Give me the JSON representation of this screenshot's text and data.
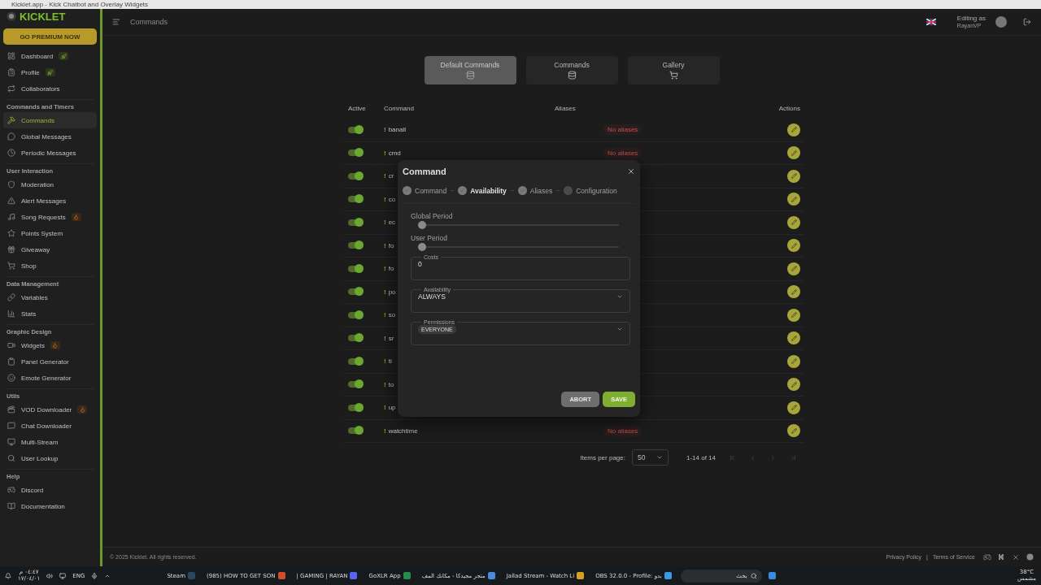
{
  "browser_title": "Kicklet.app - Kick Chatbot and Overlay Widgets",
  "sidebar": {
    "logo": "KICKLET",
    "premium_button": "GO PREMIUM NOW",
    "sections": [
      {
        "items": [
          {
            "label": "Dashboard",
            "kind": "rocket",
            "selected": false
          },
          {
            "label": "Profile",
            "kind": "rocket",
            "selected": false
          },
          {
            "label": "Collaborators",
            "kind": "plain",
            "selected": false
          }
        ]
      },
      {
        "title": "Commands and Timers",
        "items": [
          {
            "label": "Commands",
            "kind": "plain",
            "selected": true
          },
          {
            "label": "Global Messages",
            "kind": "plain",
            "selected": false
          },
          {
            "label": "Periodic Messages",
            "kind": "plain",
            "selected": false
          }
        ]
      },
      {
        "title": "User Interaction",
        "items": [
          {
            "label": "Moderation",
            "kind": "plain",
            "selected": false
          },
          {
            "label": "Alert Messages",
            "kind": "plain",
            "selected": false
          },
          {
            "label": "Song Requests",
            "kind": "fire",
            "selected": false
          },
          {
            "label": "Points System",
            "kind": "plain",
            "selected": false
          },
          {
            "label": "Giveaway",
            "kind": "plain",
            "selected": false
          },
          {
            "label": "Shop",
            "kind": "plain",
            "selected": false
          }
        ]
      },
      {
        "title": "Data Management",
        "items": [
          {
            "label": "Variables",
            "kind": "plain",
            "selected": false
          },
          {
            "label": "Stats",
            "kind": "plain",
            "selected": false
          }
        ]
      },
      {
        "title": "Graphic Design",
        "items": [
          {
            "label": "Widgets",
            "kind": "fire",
            "selected": false
          },
          {
            "label": "Panel Generator",
            "kind": "plain",
            "selected": false
          },
          {
            "label": "Emote Generator",
            "kind": "plain",
            "selected": false
          }
        ]
      },
      {
        "title": "Utils",
        "items": [
          {
            "label": "VOD Downloader",
            "kind": "fire",
            "selected": false
          },
          {
            "label": "Chat Downloader",
            "kind": "plain",
            "selected": false
          },
          {
            "label": "Multi-Stream",
            "kind": "plain",
            "selected": false
          },
          {
            "label": "User Lookup",
            "kind": "plain",
            "selected": false
          }
        ]
      },
      {
        "title": "Help",
        "items": [
          {
            "label": "Discord",
            "kind": "plain",
            "selected": false
          },
          {
            "label": "Documentation",
            "kind": "plain",
            "selected": false
          }
        ]
      }
    ]
  },
  "header": {
    "title": "Commands",
    "editing_label": "Editing as",
    "user": "RayanVP"
  },
  "tabs": [
    {
      "label": "Default Commands",
      "selected": true
    },
    {
      "label": "Commands",
      "selected": false
    },
    {
      "label": "Gallery",
      "selected": false
    }
  ],
  "table": {
    "columns": [
      "Active",
      "Command",
      "Aliases",
      "Actions"
    ],
    "rows": [
      {
        "active": true,
        "prefix": "!",
        "command": "banall",
        "aliases": "No aliases"
      },
      {
        "active": true,
        "prefix": "!",
        "command": "cmd",
        "aliases": "No aliases"
      },
      {
        "active": true,
        "prefix": "!",
        "command": "cr"
      },
      {
        "active": true,
        "prefix": "!",
        "command": "co"
      },
      {
        "active": true,
        "prefix": "!",
        "command": "ec"
      },
      {
        "active": true,
        "prefix": "!",
        "command": "fo"
      },
      {
        "active": true,
        "prefix": "!",
        "command": "fo"
      },
      {
        "active": true,
        "prefix": "!",
        "command": "po"
      },
      {
        "active": true,
        "prefix": "!",
        "command": "so"
      },
      {
        "active": true,
        "prefix": "!",
        "command": "sr"
      },
      {
        "active": true,
        "prefix": "!",
        "command": "ti"
      },
      {
        "active": true,
        "prefix": "!",
        "command": "to"
      },
      {
        "active": true,
        "prefix": "!",
        "command": "up"
      },
      {
        "active": true,
        "prefix": "!",
        "command": "watchtime",
        "aliases": "No aliases"
      }
    ]
  },
  "pagination": {
    "label": "Items per page:",
    "per_page": "50",
    "range": "1-14 of 14"
  },
  "dialog": {
    "title": "Command",
    "steps": [
      {
        "label": "Command",
        "completed": true,
        "selected": false
      },
      {
        "label": "Availability",
        "completed": true,
        "selected": true
      },
      {
        "label": "Aliases",
        "completed": true,
        "selected": false
      },
      {
        "label": "Configuration",
        "completed": false,
        "selected": false
      }
    ],
    "sliders": [
      {
        "label": "Global Period",
        "level": 0
      },
      {
        "label": "User Period",
        "level": 0
      }
    ],
    "costs": {
      "label": "Costs",
      "value": "0"
    },
    "availability": {
      "label": "Availability",
      "value": "ALWAYS"
    },
    "permissions": {
      "label": "Permissions",
      "chips": [
        "EVERYONE"
      ]
    },
    "buttons": {
      "abort": "ABORT",
      "save": "SAVE"
    }
  },
  "footer": {
    "copyright": "© 2025 Kicklet. All rights reserved.",
    "links": [
      "Privacy Policy",
      "Terms of Service"
    ],
    "separator": "|"
  },
  "taskbar": {
    "clock": "٠٤:٤٧ م",
    "date": "١٧/٠٤/٠١",
    "language": "ENG",
    "apps": [
      {
        "label": "Steam"
      },
      {
        "label": "(985) HOW TO GET SON"
      },
      {
        "label": "| GAMING | RAYAN"
      },
      {
        "label": "GoXLR App"
      },
      {
        "label": "متجر مجيدكا - مكانك المف"
      },
      {
        "label": "Jallad Stream - Watch Li"
      },
      {
        "label": "OBS 32.0.0 - Profile: بدو"
      }
    ],
    "search": "بحث",
    "temperature": "38°C",
    "weather": "مشمس"
  }
}
